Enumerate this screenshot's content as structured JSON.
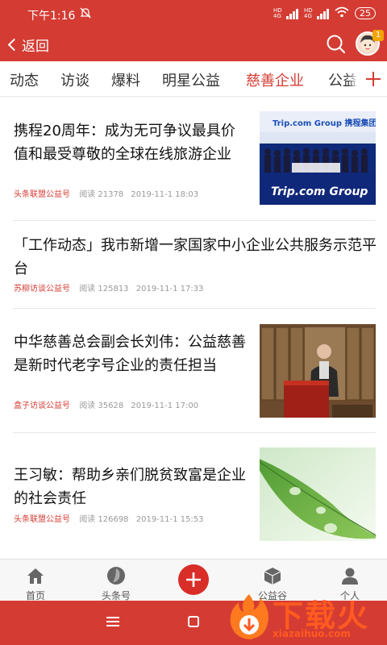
{
  "status_bar": {
    "time": "下午1:16",
    "network_1": "HD 4G",
    "network_2": "HD 4G",
    "battery": "25"
  },
  "header": {
    "back_label": "返回",
    "badge_count": "1",
    "accent_color": "#d43c33"
  },
  "tabs": [
    {
      "label": "动态"
    },
    {
      "label": "访谈"
    },
    {
      "label": "爆料"
    },
    {
      "label": "明星公益"
    },
    {
      "label": "慈善企业"
    },
    {
      "label": "公益"
    }
  ],
  "active_tab": "慈善企业",
  "news": [
    {
      "title": "携程20周年：成为无可争议最具价值和最受尊敬的全球在线旅游企业",
      "source": "头条联盟公益号",
      "views": "阅读 21378",
      "date": "2019-11-1 18:03",
      "thumb_text": "Trip.com Group 携程集团",
      "thumb_banner": "Trip.com Group"
    },
    {
      "title": "「工作动态」我市新增一家国家中小企业公共服务示范平台",
      "source": "苏柳访谈公益号",
      "views": "阅读 125813",
      "date": "2019-11-1 17:33"
    },
    {
      "title": "中华慈善总会副会长刘伟：公益慈善是新时代老字号企业的责任担当",
      "source": "盒子访谈公益号",
      "views": "阅读 35628",
      "date": "2019-11-1 17:00"
    },
    {
      "title": "王习敏：帮助乡亲们脱贫致富是企业的社会责任",
      "source": "头条联盟公益号",
      "views": "阅读 126698",
      "date": "2019-11-1 15:53"
    }
  ],
  "bottom_nav": {
    "home": "首页",
    "headlines": "头条号",
    "welfare": "公益谷",
    "me": "个人"
  },
  "watermark": {
    "title": "下载火",
    "url": "xiazaihuo.com"
  }
}
